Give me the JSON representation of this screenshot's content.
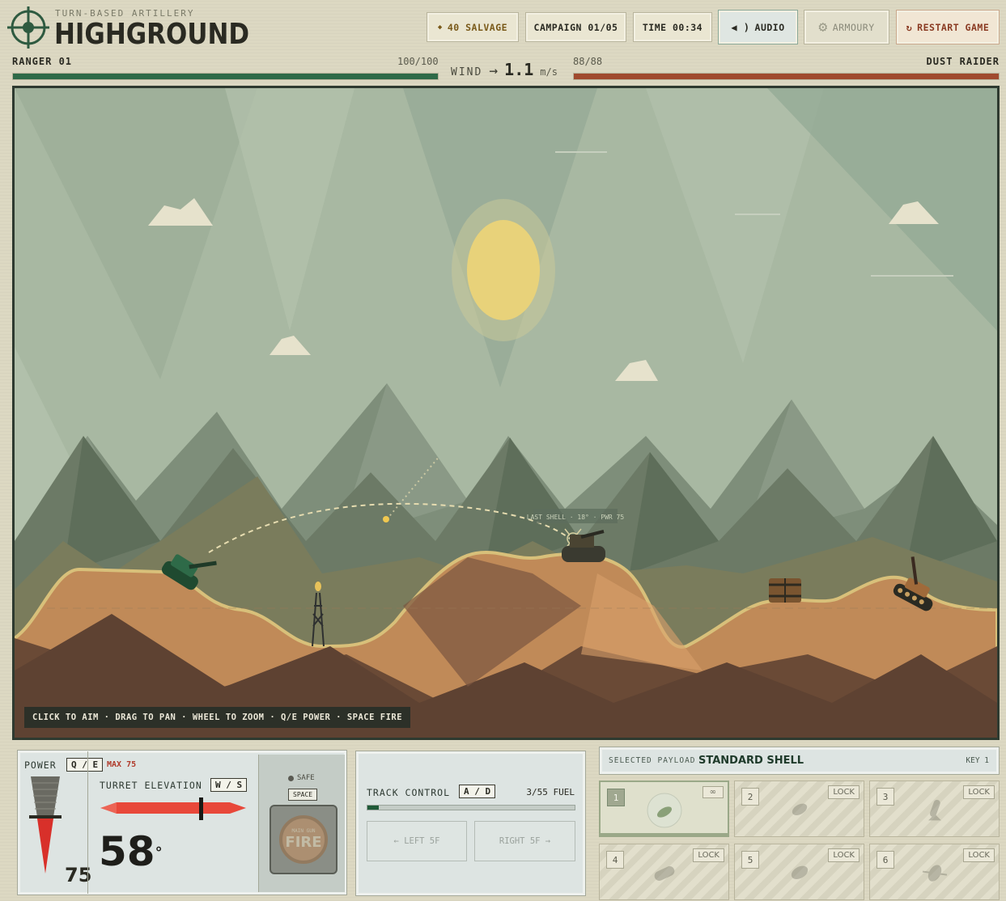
{
  "header": {
    "subtitle": "TURN-BASED ARTILLERY",
    "title": "HIGHGROUND",
    "salvage": "40 SALVAGE",
    "campaign": "CAMPAIGN 01/05",
    "time": "TIME 00:34",
    "audio": "AUDIO",
    "armoury": "ARMOURY",
    "restart": "RESTART GAME"
  },
  "player": {
    "name": "RANGER 01",
    "hp_text": "100/100",
    "hp_fraction": 1.0,
    "color": "#2e6a48"
  },
  "enemy": {
    "name": "DUST RAIDER",
    "hp_text": "88/88",
    "hp_fraction": 1.0,
    "color": "#a04a2e"
  },
  "wind": {
    "label": "WIND",
    "arrow": "→",
    "value": "1.1",
    "unit": "m/s"
  },
  "game": {
    "hint": "CLICK TO AIM · DRAG TO PAN · WHEEL TO ZOOM · Q/E POWER · SPACE FIRE",
    "last_shell": "LAST SHELL · 18° · PWR 75"
  },
  "power": {
    "label": "POWER",
    "key": "Q / E",
    "max": "MAX 75",
    "value": "75",
    "fraction": 1.0
  },
  "elevation": {
    "label": "TURRET ELEVATION",
    "key": "W / S",
    "value": "58",
    "unit": "°"
  },
  "fire": {
    "safe": "SAFE",
    "space": "SPACE",
    "button_top": "MAIN GUN",
    "button": "FIRE"
  },
  "track": {
    "label": "TRACK CONTROL",
    "key": "A / D",
    "fuel": "3/55 FUEL",
    "fuel_fraction": 0.055,
    "left": "←  LEFT 5F",
    "right": "RIGHT 5F  →"
  },
  "payload": {
    "label": "SELECTED PAYLOAD",
    "name": "STANDARD SHELL",
    "key": "KEY 1",
    "slots": [
      {
        "num": "1",
        "badge": "∞",
        "icon": "shell-icon"
      },
      {
        "num": "2",
        "lock": "LOCK",
        "icon": "cluster-icon"
      },
      {
        "num": "3",
        "lock": "LOCK",
        "icon": "rocket-icon"
      },
      {
        "num": "4",
        "lock": "LOCK",
        "icon": "heavy-shell-icon"
      },
      {
        "num": "5",
        "lock": "LOCK",
        "icon": "mine-icon"
      },
      {
        "num": "6",
        "lock": "LOCK",
        "icon": "drill-icon"
      }
    ]
  }
}
